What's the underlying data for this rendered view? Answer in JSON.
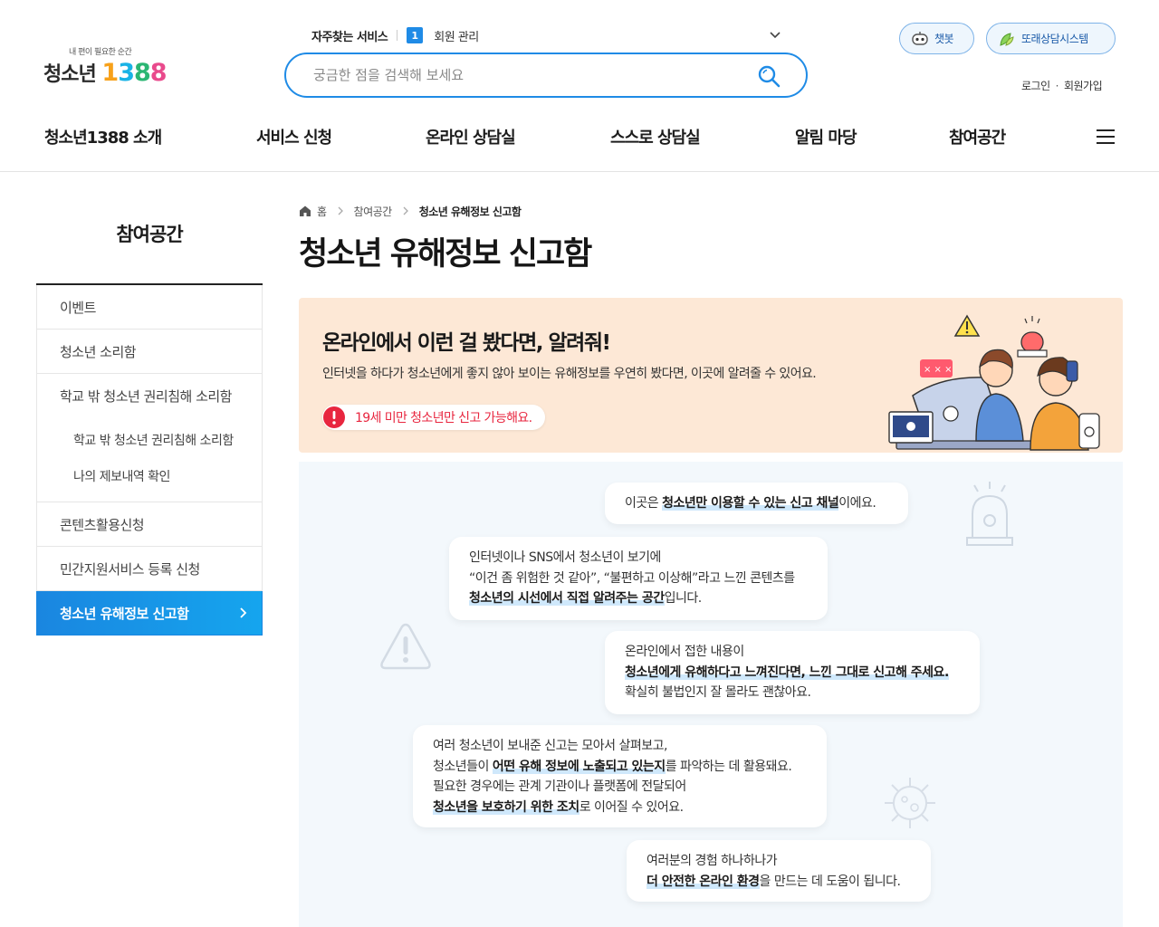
{
  "header": {
    "logo": {
      "tagline": "내 편이 필요한 순간",
      "name": "청소년",
      "number": [
        "1",
        "3",
        "8",
        "8"
      ]
    },
    "frequent": {
      "label": "자주찾는 서비스",
      "index": "1",
      "item": "회원 관리"
    },
    "search": {
      "placeholder": "궁금한 점을 검색해 보세요"
    },
    "buttons": {
      "chatbot": "챗봇",
      "counsel": "또래상담시스템"
    },
    "auth": {
      "login": "로그인",
      "separator": "·",
      "signup": "회원가입"
    }
  },
  "gnb": [
    "청소년1388 소개",
    "서비스 신청",
    "온라인 상담실",
    "스스로 상담실",
    "알림 마당",
    "참여공간"
  ],
  "sidebar": {
    "title": "참여공간",
    "items": [
      {
        "label": "이벤트"
      },
      {
        "label": "청소년 소리함"
      },
      {
        "label": "학교 밖 청소년 권리침해 소리함",
        "children": [
          "학교 밖 청소년 권리침해 소리함",
          "나의 제보내역 확인"
        ]
      },
      {
        "label": "콘텐츠활용신청"
      },
      {
        "label": "민간지원서비스 등록 신청"
      },
      {
        "label": "청소년 유해정보 신고함",
        "active": true
      }
    ]
  },
  "breadcrumb": {
    "home": "홈",
    "section": "참여공간",
    "current": "청소년 유해정보 신고함"
  },
  "page": {
    "title": "청소년 유해정보 신고함"
  },
  "banner": {
    "title": "온라인에서 이런 걸 봤다면, 알려줘!",
    "description": "인터넷을 하다가 청소년에게 좋지 않아 보이는 유해정보를 우연히 봤다면, 이곳에 알려줄 수 있어요.",
    "notice": "19세 미만 청소년만 신고 가능해요.",
    "illust_mark": "× × ×"
  },
  "bubbles": {
    "b1": {
      "pre": "이곳은 ",
      "hl": "청소년만 이용할 수 있는 신고 채널",
      "post": "이에요."
    },
    "b2": {
      "l1": "인터넷이나 SNS에서 청소년이 보기에",
      "l2": "“이건 좀 위험한 것 같아”, “불편하고 이상해”라고 느낀 콘텐츠를",
      "l3_hl": "청소년의 시선에서 직접 알려주는 공간",
      "l3_post": "입니다."
    },
    "b3": {
      "l1": "온라인에서 접한 내용이",
      "l2_hl": "청소년에게 유해하다고 느껴진다면, 느낀 그대로 신고해 주세요.",
      "l3": "확실히 불법인지 잘 몰라도 괜찮아요."
    },
    "b4": {
      "l1": "여러 청소년이 보내준 신고는 모아서 살펴보고,",
      "l2_pre": "청소년들이 ",
      "l2_hl": "어떤 유해 정보에 노출되고 있는지",
      "l2_post": "를 파악하는 데 활용돼요.",
      "l3": "필요한 경우에는 관계 기관이나 플랫폼에 전달되어",
      "l4_hl": "청소년을 보호하기 위한 조치",
      "l4_post": "로 이어질 수 있어요."
    },
    "b5": {
      "l1": "여러분의 경험 하나하나가",
      "l2_hl": "더 안전한 온라인 환경",
      "l2_post": "을 만드는 데 도움이 됩니다."
    }
  },
  "colors": {
    "accent": "#1f8be6",
    "active_nav": "#1a86e0",
    "banner_bg": "#fde8d6",
    "notice_red": "#e8263f",
    "chat_bg": "#f3f8fc"
  },
  "icons": {
    "search": "search-icon",
    "chatbot": "robot-icon",
    "counsel": "leaf-icon",
    "menu": "hamburger-icon",
    "home": "home-icon",
    "warning": "exclamation-icon"
  }
}
